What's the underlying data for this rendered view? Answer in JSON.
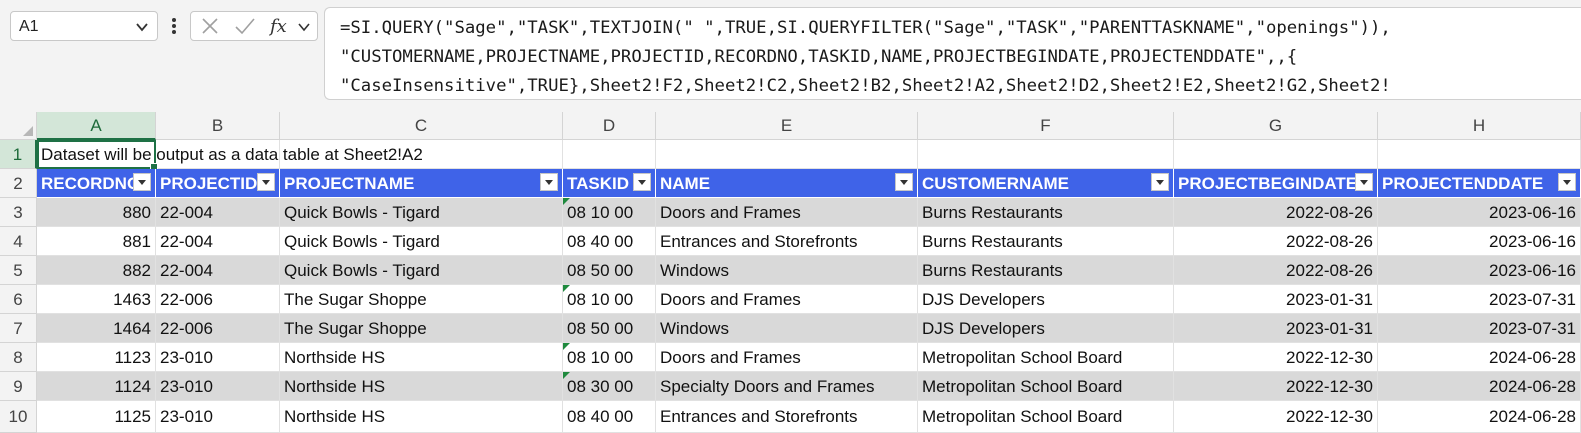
{
  "formula_bar": {
    "name_box": "A1",
    "formula_lines": [
      "=SI.QUERY(\"Sage\",\"TASK\",TEXTJOIN(\" \",TRUE,SI.QUERYFILTER(\"Sage\",\"TASK\",\"PARENTTASKNAME\",\"openings\")),",
      "\"CUSTOMERNAME,PROJECTNAME,PROJECTID,RECORDNO,TASKID,NAME,PROJECTBEGINDATE,PROJECTENDDATE\",,{",
      "\"CaseInsensitive\",TRUE},Sheet2!F2,Sheet2!C2,Sheet2!B2,Sheet2!A2,Sheet2!D2,Sheet2!E2,Sheet2!G2,Sheet2!"
    ]
  },
  "sheet": {
    "columns": [
      "A",
      "B",
      "C",
      "D",
      "E",
      "F",
      "G",
      "H"
    ],
    "row_numbers": [
      "1",
      "2",
      "3",
      "4",
      "5",
      "6",
      "7",
      "8",
      "9",
      "10"
    ],
    "note": "Dataset will be output as a data table at Sheet2!A2",
    "headers": [
      "RECORDNO",
      "PROJECTID",
      "PROJECTNAME",
      "TASKID",
      "NAME",
      "CUSTOMERNAME",
      "PROJECTBEGINDATE",
      "PROJECTENDDATE"
    ],
    "rows": [
      {
        "recordno": "880",
        "projectid": "22-004",
        "projectname": "Quick Bowls - Tigard",
        "taskid": "08 10 00",
        "name": "Doors and Frames",
        "customername": "Burns Restaurants",
        "begin": "2022-08-26",
        "end": "2023-06-16",
        "flag": true
      },
      {
        "recordno": "881",
        "projectid": "22-004",
        "projectname": "Quick Bowls - Tigard",
        "taskid": "08 40 00",
        "name": "Entrances and Storefronts",
        "customername": "Burns Restaurants",
        "begin": "2022-08-26",
        "end": "2023-06-16",
        "flag": false
      },
      {
        "recordno": "882",
        "projectid": "22-004",
        "projectname": "Quick Bowls - Tigard",
        "taskid": "08 50 00",
        "name": "Windows",
        "customername": "Burns Restaurants",
        "begin": "2022-08-26",
        "end": "2023-06-16",
        "flag": false
      },
      {
        "recordno": "1463",
        "projectid": "22-006",
        "projectname": "The Sugar Shoppe",
        "taskid": "08 10 00",
        "name": "Doors and Frames",
        "customername": "DJS Developers",
        "begin": "2023-01-31",
        "end": "2023-07-31",
        "flag": true
      },
      {
        "recordno": "1464",
        "projectid": "22-006",
        "projectname": "The Sugar Shoppe",
        "taskid": "08 50 00",
        "name": "Windows",
        "customername": "DJS Developers",
        "begin": "2023-01-31",
        "end": "2023-07-31",
        "flag": false
      },
      {
        "recordno": "1123",
        "projectid": "23-010",
        "projectname": "Northside HS",
        "taskid": "08 10 00",
        "name": "Doors and Frames",
        "customername": "Metropolitan School Board",
        "begin": "2022-12-30",
        "end": "2024-06-28",
        "flag": true
      },
      {
        "recordno": "1124",
        "projectid": "23-010",
        "projectname": "Northside HS",
        "taskid": "08 30 00",
        "name": "Specialty Doors and Frames",
        "customername": "Metropolitan School Board",
        "begin": "2022-12-30",
        "end": "2024-06-28",
        "flag": true
      },
      {
        "recordno": "1125",
        "projectid": "23-010",
        "projectname": "Northside HS",
        "taskid": "08 40 00",
        "name": "Entrances and Storefronts",
        "customername": "Metropolitan School Board",
        "begin": "2022-12-30",
        "end": "2024-06-28",
        "flag": false
      }
    ]
  },
  "colors": {
    "header_blue": "#3f63e8",
    "band_gray": "#d9d9d9",
    "select_green": "#1e7145"
  }
}
